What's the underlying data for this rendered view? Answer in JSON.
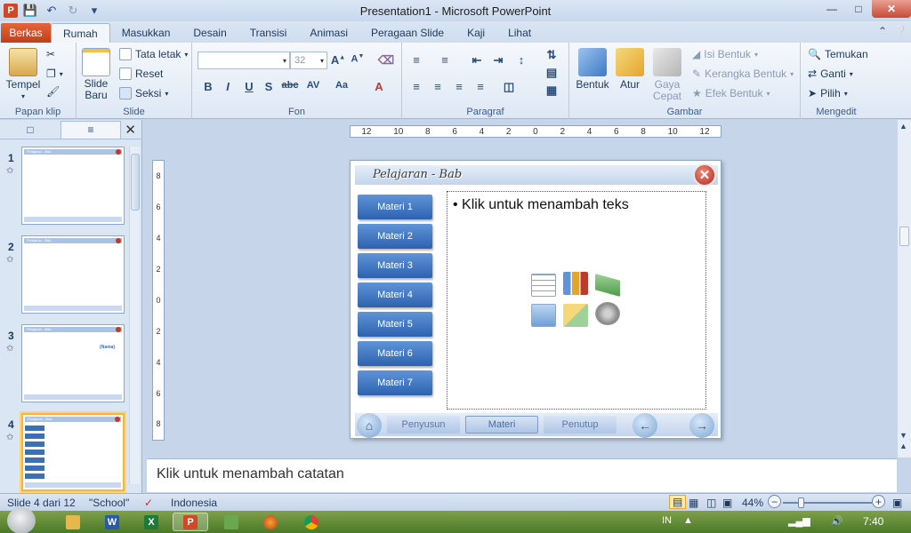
{
  "window": {
    "title": "Presentation1  -  Microsoft PowerPoint",
    "min_icon": "minimize-icon",
    "max_icon": "maximize-icon",
    "close_icon": "close-icon"
  },
  "tabs": {
    "file": "Berkas",
    "items": [
      "Rumah",
      "Masukkan",
      "Desain",
      "Transisi",
      "Animasi",
      "Peragaan Slide",
      "Kaji",
      "Lihat"
    ],
    "active": "Rumah"
  },
  "ribbon": {
    "clipboard": {
      "label": "Papan klip",
      "paste": "Tempel"
    },
    "slides": {
      "label": "Slide",
      "new_slide_1": "Slide",
      "new_slide_2": "Baru",
      "layout": "Tata letak",
      "reset": "Reset",
      "section": "Seksi"
    },
    "font": {
      "label": "Fon",
      "font_name": "",
      "font_size": "32"
    },
    "paragraph": {
      "label": "Paragraf"
    },
    "drawing": {
      "label": "Gambar",
      "shapes": "Bentuk",
      "arrange": "Atur",
      "quick_styles_1": "Gaya",
      "quick_styles_2": "Cepat",
      "shape_fill": "Isi Bentuk",
      "shape_outline": "Kerangka Bentuk",
      "shape_effects": "Efek Bentuk"
    },
    "editing": {
      "label": "Mengedit",
      "find": "Temukan",
      "replace": "Ganti",
      "select": "Pilih"
    }
  },
  "slide_pane": {
    "slides": [
      {
        "num": "1"
      },
      {
        "num": "2"
      },
      {
        "num": "3"
      },
      {
        "num": "4"
      }
    ],
    "thumb_title": "Pelajaran - Bab",
    "thumb3_label": "(Nama)"
  },
  "ruler": {
    "h": [
      "12",
      "10",
      "8",
      "6",
      "4",
      "2",
      "0",
      "2",
      "4",
      "6",
      "8",
      "10",
      "12"
    ],
    "v": [
      "8",
      "6",
      "4",
      "2",
      "0",
      "2",
      "4",
      "6",
      "8"
    ]
  },
  "slide": {
    "title": "Pelajaran  -  Bab",
    "materi": [
      "Materi 1",
      "Materi 2",
      "Materi 3",
      "Materi 4",
      "Materi 5",
      "Materi 6",
      "Materi 7"
    ],
    "placeholder_text": "Klik untuk menambah teks",
    "footer": {
      "penyusun": "Penyusun",
      "materi": "Materi",
      "penutup": "Penutup"
    }
  },
  "notes": {
    "placeholder": "Klik untuk menambah catatan"
  },
  "status": {
    "slide_info": "Slide 4 dari 12",
    "theme": "\"School\"",
    "language": "Indonesia",
    "zoom": "44%"
  },
  "taskbar": {
    "lang": "IN",
    "time": "7:40"
  },
  "colors": {
    "accent_blue": "#2d62b0",
    "file_tab": "#c43d17",
    "taskbar": "#4a7a26"
  }
}
